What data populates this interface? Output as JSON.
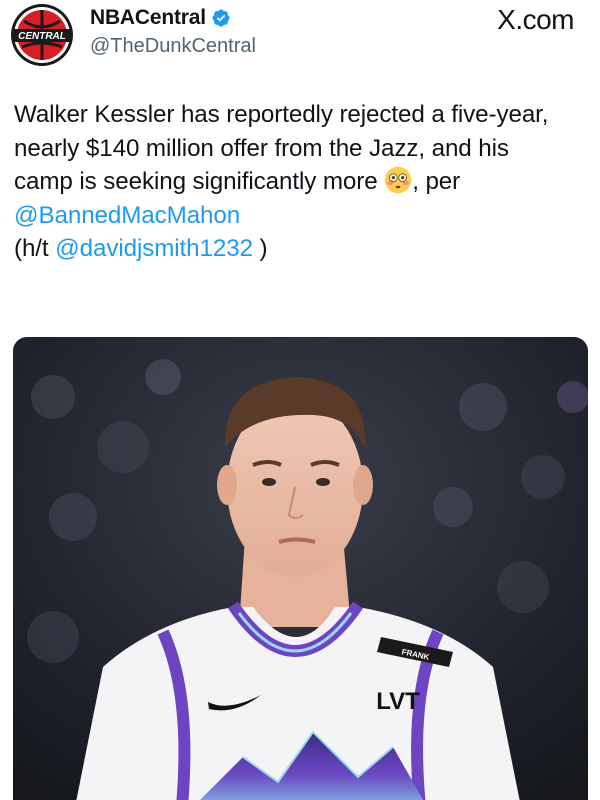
{
  "author": {
    "display_name": "NBACentral",
    "handle": "@TheDunkCentral",
    "avatar_icon": "nbacentral-logo-icon",
    "avatar_text": "CENTRAL",
    "verified_icon": "verified-badge-icon",
    "verified_color": "#1d9bf0"
  },
  "source_label": "X.com",
  "tweet": {
    "line1": "Walker Kessler has reportedly rejected a five-year,",
    "line2": "nearly $140 million offer from the Jazz, and his",
    "line3_before_emoji": "camp is seeking significantly more ",
    "emoji_icon": "flushed-face-emoji",
    "line3_after_emoji": ", per",
    "mention1": "@BannedMacMahon",
    "hat_tip_open": "(h/t ",
    "mention2": "@davidjsmith1232",
    "hat_tip_close": " )",
    "link_color": "#1d9bf0"
  },
  "media": {
    "kind": "photo of basketball player in white Utah Jazz jersey",
    "jersey_patch_text": "LVT",
    "armband_text": "FRANK"
  }
}
